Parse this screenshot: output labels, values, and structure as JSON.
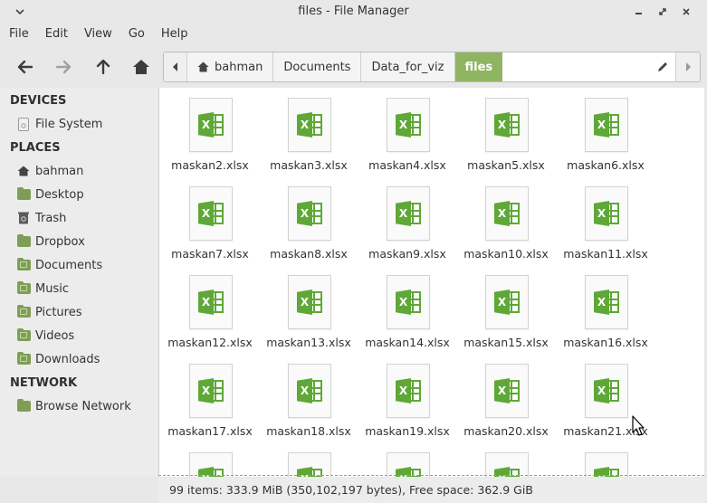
{
  "window": {
    "title": "files - File Manager",
    "controls": [
      "minimize-icon",
      "restore-icon",
      "close-icon"
    ]
  },
  "menu": [
    "File",
    "Edit",
    "View",
    "Go",
    "Help"
  ],
  "toolbar": {
    "buttons": [
      "back-arrow-icon",
      "forward-arrow-icon",
      "up-arrow-icon",
      "home-icon"
    ]
  },
  "pathbar": {
    "crumbs": [
      "bahman",
      "Documents",
      "Data_for_viz",
      "files"
    ],
    "active_index": 3,
    "accent": "#8fb563"
  },
  "sidebar": {
    "devices_heading": "DEVICES",
    "devices": [
      {
        "label": "File System",
        "icon": "drive-icon"
      }
    ],
    "places_heading": "PLACES",
    "places": [
      {
        "label": "bahman",
        "icon": "home-icon"
      },
      {
        "label": "Desktop",
        "icon": "desktop-folder-icon"
      },
      {
        "label": "Trash",
        "icon": "trash-icon"
      },
      {
        "label": "Dropbox",
        "icon": "folder-icon"
      },
      {
        "label": "Documents",
        "icon": "documents-folder-icon"
      },
      {
        "label": "Music",
        "icon": "music-folder-icon"
      },
      {
        "label": "Pictures",
        "icon": "pictures-folder-icon"
      },
      {
        "label": "Videos",
        "icon": "videos-folder-icon"
      },
      {
        "label": "Downloads",
        "icon": "downloads-folder-icon"
      }
    ],
    "network_heading": "NETWORK",
    "network": [
      {
        "label": "Browse Network",
        "icon": "network-folder-icon"
      }
    ]
  },
  "files": [
    "maskan2.xlsx",
    "maskan3.xlsx",
    "maskan4.xlsx",
    "maskan5.xlsx",
    "maskan6.xlsx",
    "maskan7.xlsx",
    "maskan8.xlsx",
    "maskan9.xlsx",
    "maskan10.xlsx",
    "maskan11.xlsx",
    "maskan12.xlsx",
    "maskan13.xlsx",
    "maskan14.xlsx",
    "maskan15.xlsx",
    "maskan16.xlsx",
    "maskan17.xlsx",
    "maskan18.xlsx",
    "maskan19.xlsx",
    "maskan20.xlsx",
    "maskan21.xlsx",
    "",
    "",
    "",
    "",
    ""
  ],
  "file_icon": "xlsx-spreadsheet-icon",
  "status": "99 items: 333.9 MiB (350,102,197 bytes), Free space: 362.9 GiB"
}
